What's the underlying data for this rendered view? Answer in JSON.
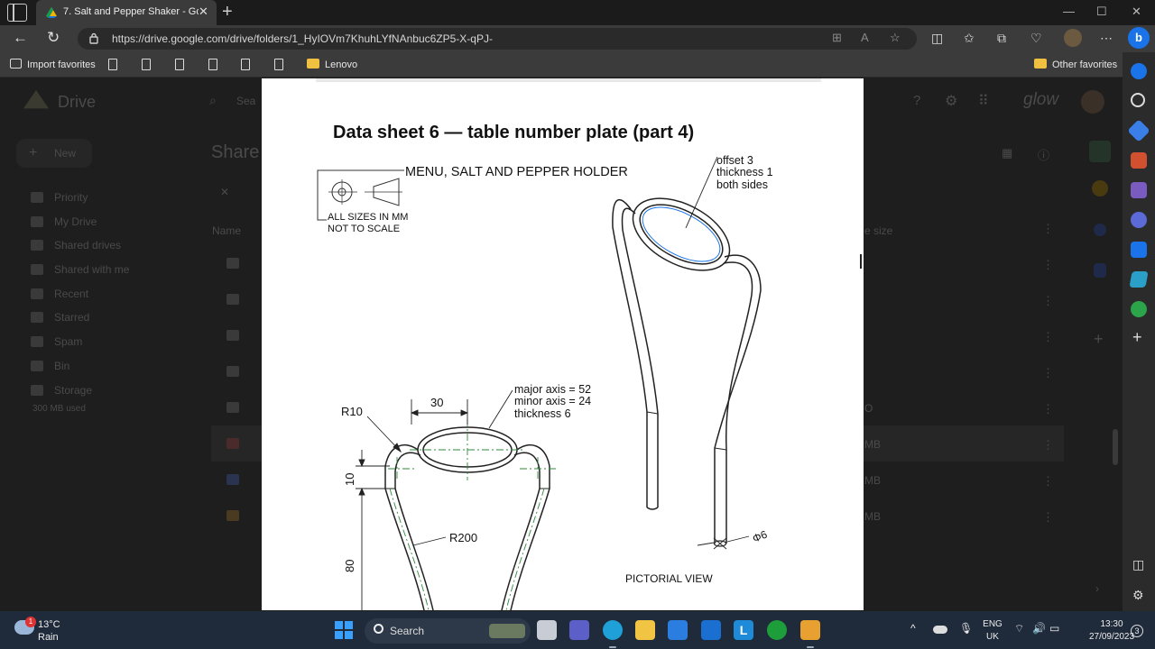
{
  "browser": {
    "tab_title": "7. Salt and Pepper Shaker - Goog",
    "url": "https://drive.google.com/drive/folders/1_HyIOVm7KhuhLYfNAnbuc6ZP5-X-qPJ-",
    "favorites": [
      {
        "label": "Import favorites",
        "icon": "import-icon"
      },
      {
        "label": "",
        "icon": "page-icon"
      },
      {
        "label": "",
        "icon": "page-icon"
      },
      {
        "label": "",
        "icon": "page-icon"
      },
      {
        "label": "",
        "icon": "page-icon"
      },
      {
        "label": "",
        "icon": "page-icon"
      },
      {
        "label": "Lenovo",
        "icon": "folder-icon"
      }
    ],
    "other_favorites": "Other favorites"
  },
  "drive_bg": {
    "logo_text": "Drive",
    "search_placeholder": "Sea",
    "new_button": "New",
    "shared_title": "Share",
    "sidebar": [
      "Priority",
      "My Drive",
      "Shared drives",
      "Shared with me",
      "Recent",
      "Starred",
      "Spam",
      "Bin",
      "Storage"
    ],
    "storage_used": "300 MB used",
    "col_name": "Name",
    "col_size": "e size",
    "brand": "glow",
    "sizes": [
      "",
      "",
      "",
      "",
      "O",
      "MB",
      "MB",
      "MB"
    ]
  },
  "document": {
    "title": "Data sheet 6 — table number plate (part 4)",
    "heading": "MENU, SALT AND PEPPER HOLDER",
    "note_line1": "ALL SIZES IN MM",
    "note_line2": "NOT TO SCALE",
    "ann_offset": [
      "offset 3",
      "thickness 1",
      "both sides"
    ],
    "ann_axis": [
      "major axis = 52",
      "minor axis = 24",
      "thickness 6"
    ],
    "dim_30": "30",
    "dim_r10": "R10",
    "dim_10": "10",
    "dim_r200": "R200",
    "dim_80": "80",
    "dim_phi6": "Φ6",
    "pictorial_label": "PICTORIAL VIEW"
  },
  "taskbar": {
    "temperature": "13°C",
    "weather": "Rain",
    "weather_badge": "1",
    "search_label": "Search",
    "lang_line1": "ENG",
    "lang_line2": "UK",
    "time": "13:30",
    "date": "27/09/2023",
    "notif_count": "3"
  },
  "colors": {
    "tab_bg": "#3b3b3b",
    "drawing_line": "#222222",
    "centerline": "#2e8b3a",
    "edge_blue": "#1a73e8"
  }
}
